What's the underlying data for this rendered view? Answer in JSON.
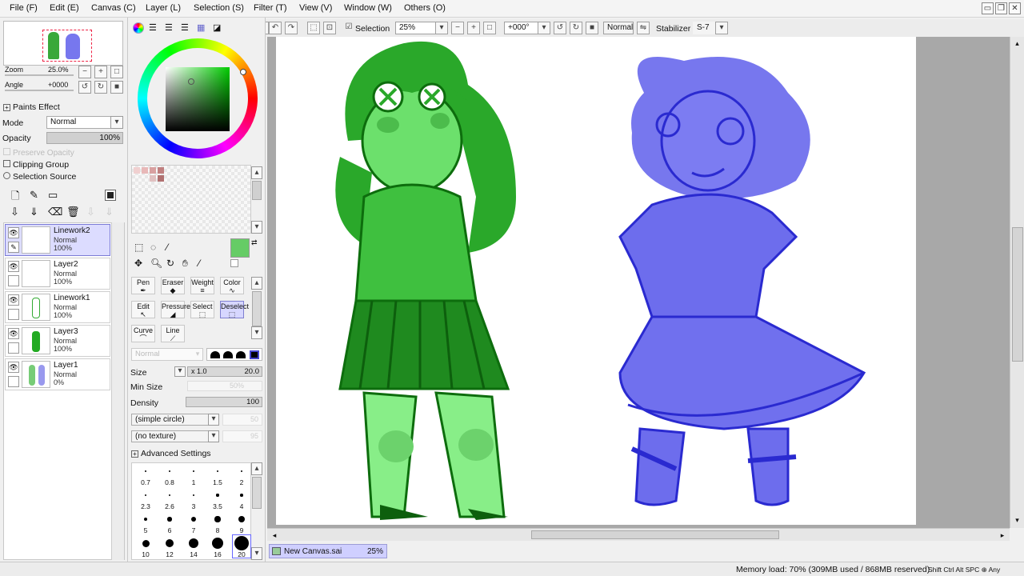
{
  "menu": {
    "file": "File (F)",
    "edit": "Edit (E)",
    "canvas": "Canvas (C)",
    "layer": "Layer (L)",
    "selection": "Selection (S)",
    "filter": "Filter (T)",
    "view": "View (V)",
    "window": "Window (W)",
    "others": "Others (O)"
  },
  "toolbar": {
    "selection_label": "Selection",
    "zoom_value": "25%",
    "angle_value": "+000°",
    "blend_mode": "Normal",
    "stabilizer_label": "Stabilizer",
    "stabilizer_value": "S-7"
  },
  "navigator": {
    "zoom_label": "Zoom",
    "zoom_value": "25.0%",
    "angle_label": "Angle",
    "angle_value": "+0000"
  },
  "layer_props": {
    "paints_effect": "Paints Effect",
    "mode_label": "Mode",
    "mode_value": "Normal",
    "opacity_label": "Opacity",
    "opacity_value": "100%",
    "preserve_opacity": "Preserve Opacity",
    "clipping_group": "Clipping Group",
    "selection_source": "Selection Source"
  },
  "layers": [
    {
      "name": "Linework2",
      "mode": "Normal",
      "opacity": "100%",
      "selected": true
    },
    {
      "name": "Layer2",
      "mode": "Normal",
      "opacity": "100%",
      "selected": false
    },
    {
      "name": "Linework1",
      "mode": "Normal",
      "opacity": "100%",
      "selected": false
    },
    {
      "name": "Layer3",
      "mode": "Normal",
      "opacity": "100%",
      "selected": false
    },
    {
      "name": "Layer1",
      "mode": "Normal",
      "opacity": "0%",
      "selected": false
    }
  ],
  "colors": {
    "current": "#66cc66",
    "swatches": [
      "#f0d0d0",
      "#e8b8b8",
      "#d8a0a0",
      "#c08080",
      "#e0c0c0",
      "#b07070"
    ]
  },
  "brushes": [
    {
      "label": "Pen"
    },
    {
      "label": "Eraser"
    },
    {
      "label": "Weight"
    },
    {
      "label": "Color"
    },
    {
      "label": "Edit"
    },
    {
      "label": "Pressure"
    },
    {
      "label": "Select"
    },
    {
      "label": "Deselect"
    },
    {
      "label": "Curve"
    },
    {
      "label": "Line"
    }
  ],
  "brush_settings": {
    "mode_value": "Normal",
    "size_label": "Size",
    "size_multiplier": "x 1.0",
    "size_value": "20.0",
    "min_size_label": "Min Size",
    "min_size_value": "50%",
    "density_label": "Density",
    "density_value": "100",
    "shape_value": "(simple circle)",
    "shape_strength": "50",
    "texture_value": "(no texture)",
    "texture_strength": "95",
    "advanced_label": "Advanced Settings"
  },
  "size_grid": [
    "0.7",
    "0.8",
    "1",
    "1.5",
    "2",
    "2.3",
    "2.6",
    "3",
    "3.5",
    "4",
    "5",
    "6",
    "7",
    "8",
    "9",
    "10",
    "12",
    "14",
    "16",
    "20"
  ],
  "document": {
    "name": "New Canvas.sai",
    "zoom": "25%"
  },
  "status": {
    "memory": "Memory load: 70% (309MB used / 868MB reserved)",
    "keys": "Shift Ctrl Alt SPC ⊕ Any"
  },
  "accent": {
    "green_char": "#22aa22",
    "blue_char": "#6f6ff0"
  }
}
